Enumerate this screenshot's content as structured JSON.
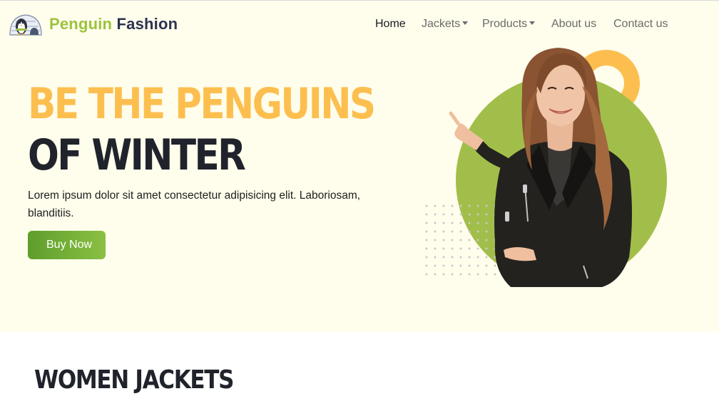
{
  "brand": {
    "part1": "Penguin",
    "part2": "Fashion"
  },
  "nav": [
    {
      "label": "Home",
      "active": true,
      "dropdown": false
    },
    {
      "label": "Jackets",
      "active": false,
      "dropdown": true
    },
    {
      "label": "Products",
      "active": false,
      "dropdown": true
    },
    {
      "label": "About us",
      "active": false,
      "dropdown": false
    },
    {
      "label": "Contact us",
      "active": false,
      "dropdown": false
    }
  ],
  "hero": {
    "headline_1": "BE THE PENGUINS",
    "headline_2": "OF WINTER",
    "lead": "Lorem ipsum dolor sit amet consectetur adipisicing elit. Laboriosam, blanditiis.",
    "cta_label": "Buy Now"
  },
  "section": {
    "title": "WOMEN JACKETS"
  },
  "colors": {
    "hero_bg": "#fffdec",
    "accent_yellow": "#fcbf4f",
    "accent_green": "#a2be4a",
    "brand_green": "#9cc33b",
    "brand_navy": "#2c3250",
    "dark_text": "#20232b"
  },
  "icons": {
    "logo": "penguin-igloo-logo-icon",
    "caret": "caret-down-icon"
  }
}
